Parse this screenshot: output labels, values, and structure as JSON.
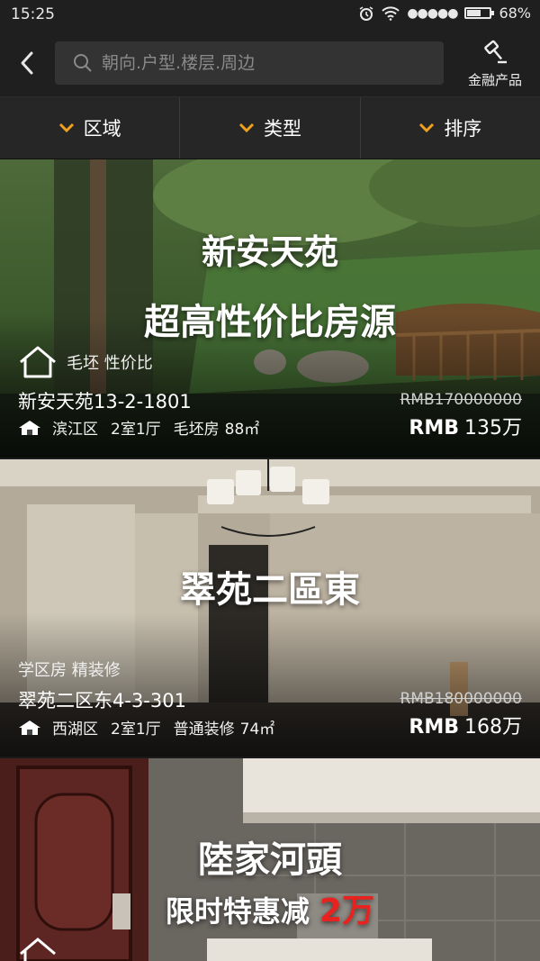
{
  "status_bar": {
    "time": "15:25",
    "battery_percent": 68,
    "battery_label": "68%",
    "signal_dots": "●●●●●"
  },
  "header": {
    "search_placeholder": "朝向.户型.楼层.周边",
    "finance_label": "金融产品"
  },
  "filters": [
    {
      "label": "区域"
    },
    {
      "label": "类型"
    },
    {
      "label": "排序"
    }
  ],
  "listings": [
    {
      "headline": "新安天苑",
      "subheadline": "超高性价比房源",
      "tags": "毛坯 性价比",
      "name": "新安天苑13-2-1801",
      "district": "滨江区",
      "layout": "2室1厅",
      "decoration": "毛坯房",
      "area": "88㎡",
      "original_price": "RMB170000000",
      "price_currency": "RMB",
      "price": "135万"
    },
    {
      "headline": "翠苑二區東",
      "tags": "学区房 精装修",
      "name": "翠苑二区东4-3-301",
      "district": "西湖区",
      "layout": "2室1厅",
      "decoration": "普通装修",
      "area": "74㎡",
      "original_price": "RMB180000000",
      "price_currency": "RMB",
      "price": "168万"
    },
    {
      "headline": "陸家河頭",
      "subheadline_prefix": "限时特惠减",
      "subheadline_highlight": "2万",
      "highlight_color": "#e8231f"
    }
  ],
  "colors": {
    "accent": "#f0a020",
    "bar_bg": "#1f1f1f",
    "filter_bg": "#262626"
  }
}
